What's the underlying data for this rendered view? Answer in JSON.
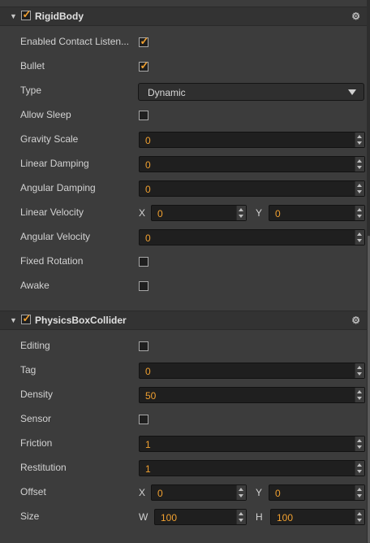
{
  "rigidbody": {
    "title": "RigidBody",
    "enabled": true,
    "props": {
      "enabled_contact_listener": {
        "label": "Enabled Contact Listen...",
        "checked": true
      },
      "bullet": {
        "label": "Bullet",
        "checked": true
      },
      "type": {
        "label": "Type",
        "value": "Dynamic"
      },
      "allow_sleep": {
        "label": "Allow Sleep",
        "checked": false
      },
      "gravity_scale": {
        "label": "Gravity Scale",
        "value": "0"
      },
      "linear_damping": {
        "label": "Linear Damping",
        "value": "0"
      },
      "angular_damping": {
        "label": "Angular Damping",
        "value": "0"
      },
      "linear_velocity": {
        "label": "Linear Velocity",
        "x_label": "X",
        "x": "0",
        "y_label": "Y",
        "y": "0"
      },
      "angular_velocity": {
        "label": "Angular Velocity",
        "value": "0"
      },
      "fixed_rotation": {
        "label": "Fixed Rotation",
        "checked": false
      },
      "awake": {
        "label": "Awake",
        "checked": false
      }
    }
  },
  "collider": {
    "title": "PhysicsBoxCollider",
    "enabled": true,
    "props": {
      "editing": {
        "label": "Editing",
        "checked": false
      },
      "tag": {
        "label": "Tag",
        "value": "0"
      },
      "density": {
        "label": "Density",
        "value": "50"
      },
      "sensor": {
        "label": "Sensor",
        "checked": false
      },
      "friction": {
        "label": "Friction",
        "value": "1"
      },
      "restitution": {
        "label": "Restitution",
        "value": "1"
      },
      "offset": {
        "label": "Offset",
        "x_label": "X",
        "x": "0",
        "y_label": "Y",
        "y": "0"
      },
      "size": {
        "label": "Size",
        "w_label": "W",
        "w": "100",
        "h_label": "H",
        "h": "100"
      }
    }
  },
  "icons": {
    "fold": "caret-down-icon",
    "settings": "gear-icon",
    "check": "checkmark-icon"
  },
  "colors": {
    "background": "#3c3c3c",
    "field": "#1f1f1f",
    "accent": "#f0a030",
    "text": "#d2d2d2"
  }
}
